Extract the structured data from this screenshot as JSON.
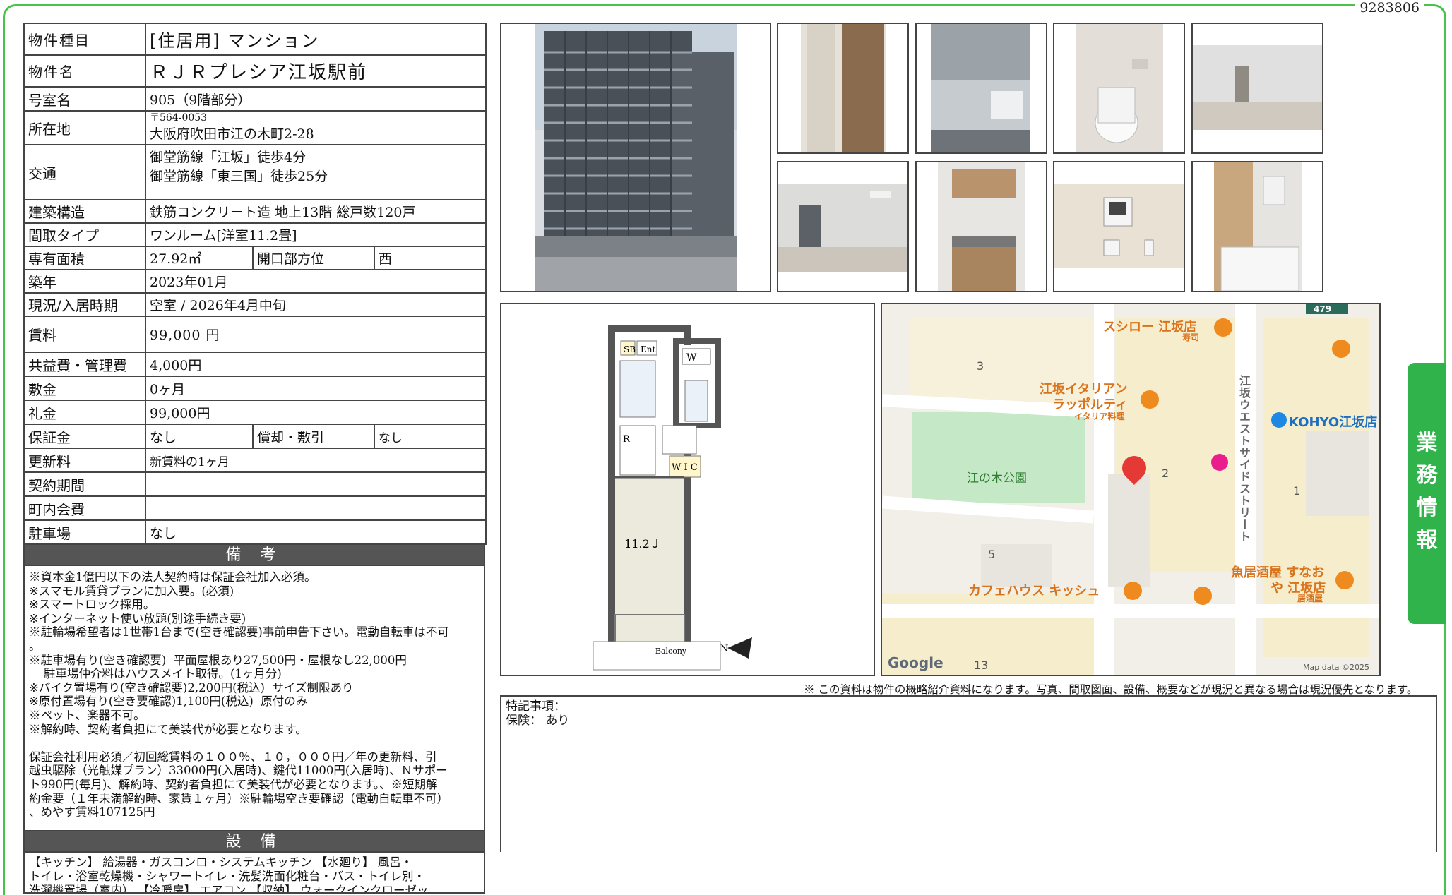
{
  "doc_id": "9283806",
  "property": {
    "type_label": "物件種目",
    "type_value": "[住居用]  マンション",
    "name_label": "物件名",
    "name_value": "ＲＪＲプレシア江坂駅前",
    "room_label": "号室名",
    "room_value": "905（9階部分）",
    "address_label": "所在地",
    "postal": "〒564-0053",
    "address": "大阪府吹田市江の木町2-28",
    "access_label": "交通",
    "access_1": "御堂筋線「江坂」徒歩4分",
    "access_2": "御堂筋線「東三国」徒歩25分",
    "structure_label": "建築構造",
    "structure_value": "鉄筋コンクリート造  地上13階  総戸数120戸",
    "layout_label": "間取タイプ",
    "layout_value": "ワンルーム[洋室11.2畳]",
    "area_label": "専有面積",
    "area_value": "27.92㎡",
    "direction_label": "開口部方位",
    "direction_value": "西",
    "built_label": "築年",
    "built_value": "2023年01月",
    "status_label": "現況/入居時期",
    "status_value": "空室  /  2026年4月中旬",
    "rent_label": "賃料",
    "rent_value": "99,000 円",
    "fee_label": "共益費・管理費",
    "fee_value": "4,000円",
    "deposit_label": "敷金",
    "deposit_value": "0ヶ月",
    "keymoney_label": "礼金",
    "keymoney_value": "99,000円",
    "guarantee_label": "保証金",
    "guarantee_value": "なし",
    "amort_label": "償却・敷引",
    "amort_value": "なし",
    "renewal_label": "更新料",
    "renewal_value": "新賃料の1ヶ月",
    "contract_label": "契約期間",
    "contract_value": "",
    "assoc_label": "町内会費",
    "assoc_value": "",
    "parking_label": "駐車場",
    "parking_value": "なし"
  },
  "remarks": {
    "title": "備 考",
    "text": "※資本金1億円以下の法人契約時は保証会社加入必須。\n※スマモル賃貸プランに加入要。(必須)\n※スマートロック採用。\n※インターネット使い放題(別途手続き要)\n※駐輪場希望者は1世帯1台まで(空き確認要)事前申告下さい。電動自転車は不可\n。\n※駐車場有り(空き確認要)  平面屋根あり27,500円・屋根なし22,000円\n    駐車場仲介料はハウスメイト取得。(1ヶ月分)\n※バイク置場有り(空き確認要)2,200円(税込)  サイズ制限あり\n※原付置場有り(空き要確認)1,100円(税込)  原付のみ\n※ペット、楽器不可。\n※解約時、契約者負担にて美装代が必要となります。\n\n保証会社利用必須／初回総賃料の１００％、１０，０００円／年の更新料、引\n越虫駆除（光触媒プラン）33000円(入居時)、鍵代11000円(入居時)、Ｎサポー\nト990円(毎月)、解約時、契約者負担にて美装代が必要となります。、※短期解\n約金要（１年未満解約時、家賃１ヶ月）※駐輪場空き要確認（電動自転車不可）\n、めやす賃料107125円"
  },
  "equipment": {
    "title": "設 備",
    "text": "【キッチン】 給湯器・ガスコンロ・システムキッチン 【水廻り】 風呂・\nトイレ・浴室乾燥機・シャワートイレ・洗髪洗面化粧台・バス・トイレ別・\n洗濯機置場（室内） 【冷暖房】 エアコン 【収納】 ウォークインクローゼッ"
  },
  "floorplan": {
    "room_size": "11.2Ｊ",
    "sb": "SB",
    "ent": "Ent",
    "w": "W",
    "r": "R",
    "wic": "W I C",
    "balcony": "Balcony",
    "north": "N"
  },
  "map": {
    "labels": {
      "sushiro": "スシロー 江坂店",
      "sushiro_sub": "寿司",
      "italian": "江坂イタリアン",
      "italian_2": "ラッポルティ",
      "italian_sub": "イタリア料理",
      "kohyo": "KOHYO江坂店",
      "park": "江の木公園",
      "street": "江坂ウエストサイドストリート",
      "cafe": "カフェハウス キッシュ",
      "izakaya": "魚居酒屋 すなお",
      "izakaya_2": "や 江坂店",
      "izakaya_sub": "居酒屋",
      "block_3": "3",
      "block_2": "2",
      "block_1": "1",
      "block_5": "5",
      "block_13": "13",
      "route": "479",
      "google": "Google",
      "mapdata": "Map data ©2025"
    },
    "colors": {
      "park": "#c5e8c6",
      "pin": "#e53935",
      "poi": "#ef8a1f",
      "shop": "#1e88e5",
      "hotel": "#e91e8c"
    }
  },
  "disclaimer": "※ この資料は物件の概略紹介資料になります。写真、間取図面、設備、概要などが現況と異なる場合は現況優先となります。",
  "special": {
    "title": "特記事項：",
    "insurance": "保険：  あり"
  },
  "side_tab": [
    "業",
    "務",
    "情",
    "報"
  ],
  "accent_color": "#2fb34a"
}
